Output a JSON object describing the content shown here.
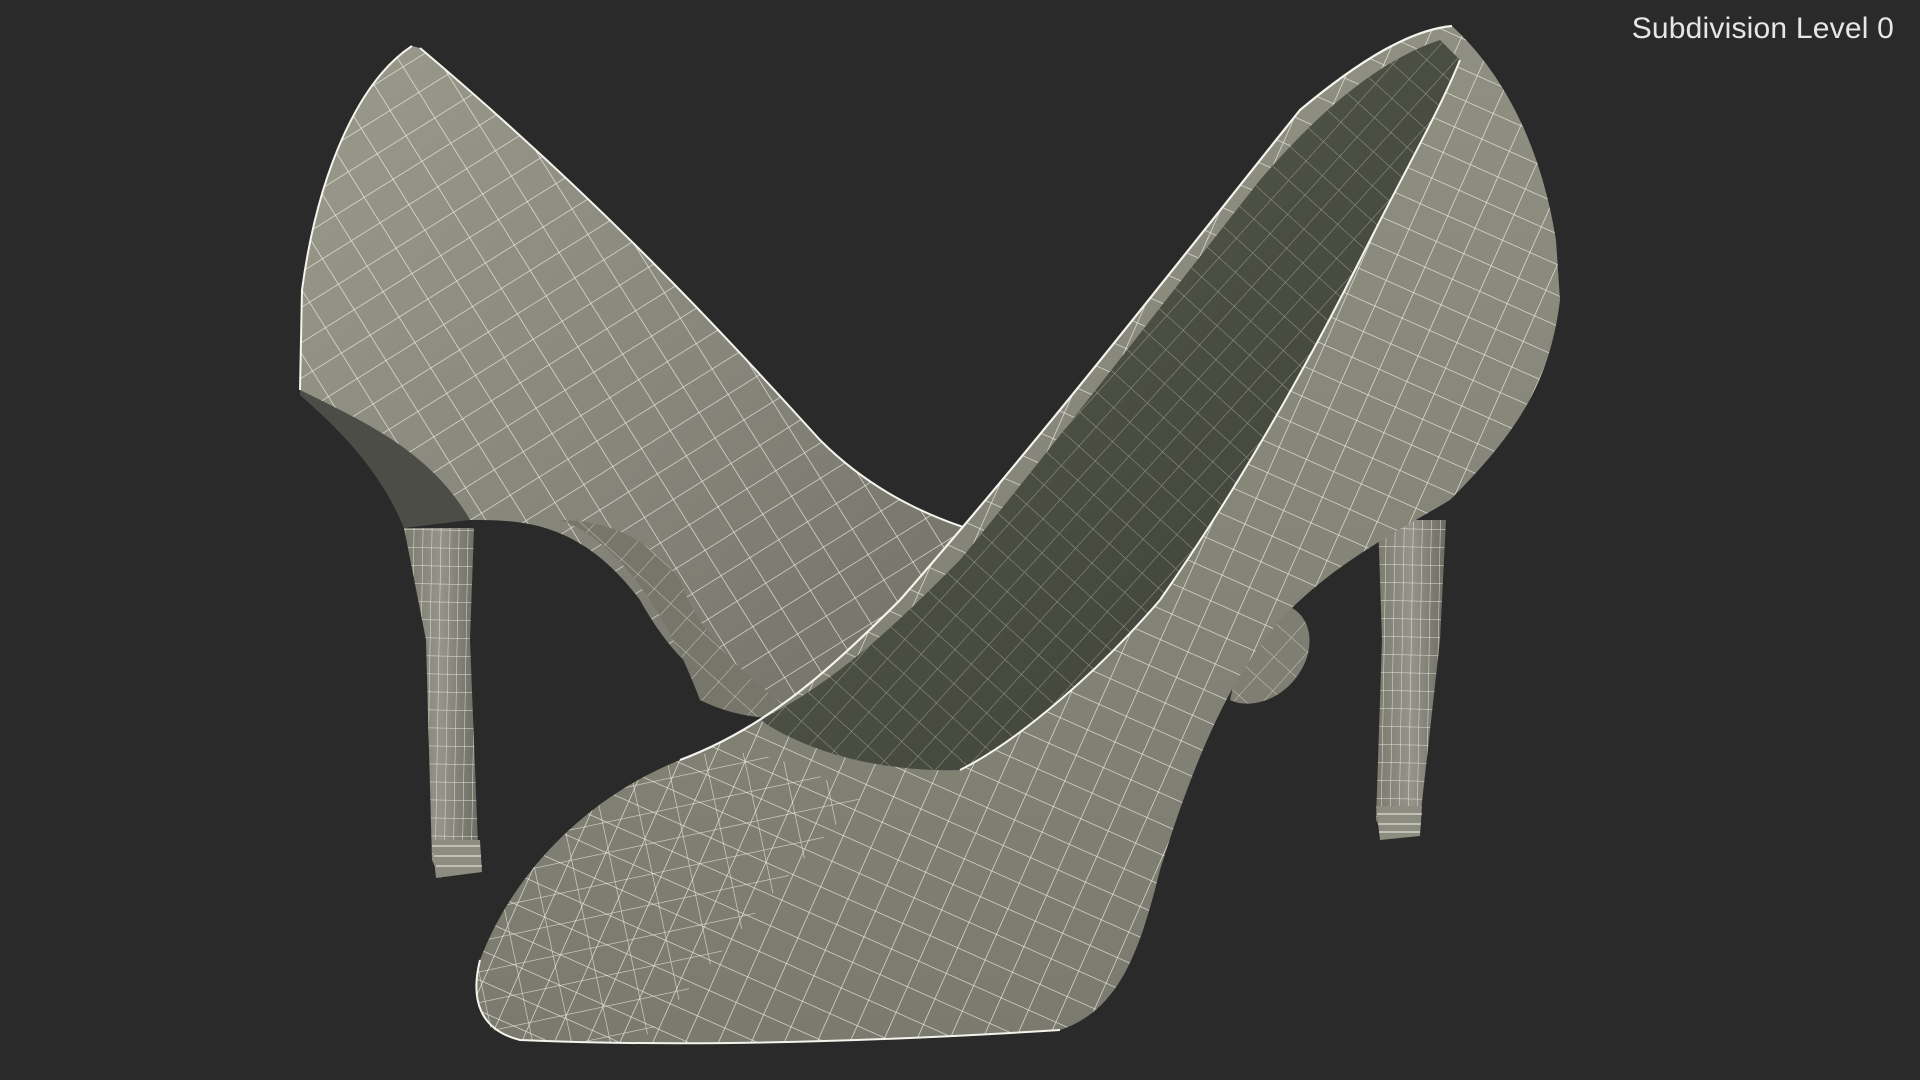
{
  "viewport": {
    "overlay_label": "Subdivision Level 0",
    "background_color": "#2a2a2a",
    "mesh_fill_color": "#8a8a7c",
    "mesh_shadow_color": "#5c5c52",
    "wire_color": "#f2f2ea"
  },
  "scene": {
    "subject": "pair of high-heel pumps wireframe mesh",
    "objects": [
      {
        "name": "left shoe (rear, heel facing viewer)"
      },
      {
        "name": "right shoe (front, toe facing viewer)"
      }
    ]
  }
}
